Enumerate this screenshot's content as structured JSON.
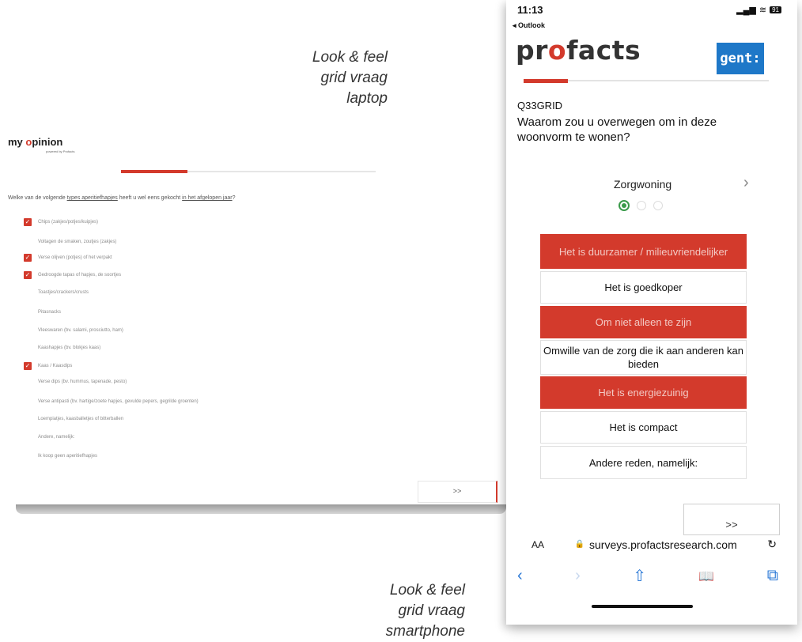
{
  "captions": {
    "laptop": [
      "Look & feel",
      "grid vraag",
      "laptop"
    ],
    "smartphone": [
      "Look & feel",
      "grid vraag",
      "smartphone"
    ]
  },
  "laptop": {
    "logo_text": "my",
    "logo_o": "o",
    "logo_rest": "pinion",
    "logo_subtitle": "powered by Profacts",
    "progress_fraction": 0.26,
    "question_prefix": "Welke van de volgende ",
    "question_link1": "types aperitiefhapjes",
    "question_middle": " heeft u wel eens gekocht ",
    "question_link2": "in het afgelopen jaar",
    "question_suffix": "?",
    "options": [
      {
        "label": "Chips (zakjes/potjes/kuipjes)",
        "checked": true
      },
      {
        "label": "Voltagen de smaken, zoutjes (zakjes)",
        "checked": false
      },
      {
        "label": "Verse olijven (potjes) of het verpakt",
        "checked": true
      },
      {
        "label": "Gedroogde tapas of hapjes, de soortjes",
        "checked": true
      },
      {
        "label": "Toastjes/crackers/crusts",
        "checked": false
      },
      {
        "label": "Pitasnacks",
        "checked": false
      },
      {
        "label": "Vleeswaren (bv. salami, prosciutto, ham)",
        "checked": false
      },
      {
        "label": "Kaashapjes (bv. blokjes kaas)",
        "checked": false
      },
      {
        "label": "Kaas / Kaasdips",
        "checked": true
      },
      {
        "label": "Verse dips (bv. hummus, tapenade, pesto)",
        "checked": false
      },
      {
        "label": "Verse antipasti (bv. hartige/zoete hapjes, gevulde pepers, gegrilde groenten)",
        "checked": false
      },
      {
        "label": "Loempiatjes, kaasballetjes of bitterballen",
        "checked": false
      },
      {
        "label": "Andere, namelijk:",
        "checked": false
      },
      {
        "label": "Ik koop geen aperitiefhapjes",
        "checked": false
      }
    ],
    "next_label": ">>"
  },
  "phone": {
    "time": "11:13",
    "back_app": "◂ Outlook",
    "battery": "91",
    "brand_pre": "pr",
    "brand_o": "o",
    "brand_post": "facts",
    "gent_logo": "gent:",
    "progress_fraction": 0.18,
    "question_id": "Q33GRID",
    "question_text": "Waarom zou u overwegen om in deze woonvorm te wonen?",
    "item_name": "Zorgwoning",
    "chevron": "›",
    "answers": [
      {
        "label": "Het is duurzamer / milieuvriendelijker",
        "selected": true
      },
      {
        "label": "Het is goedkoper",
        "selected": false
      },
      {
        "label": "Om niet alleen te zijn",
        "selected": true
      },
      {
        "label": "Omwille van de zorg die ik aan anderen kan bieden",
        "selected": false
      },
      {
        "label": "Het is energiezuinig",
        "selected": true
      },
      {
        "label": "Het is compact",
        "selected": false
      },
      {
        "label": "Andere reden, namelijk:",
        "selected": false
      }
    ],
    "next_label": ">>",
    "url_aa": "AA",
    "url": "surveys.profactsresearch.com",
    "reload_icon": "↻",
    "lock_icon": "🔒",
    "toolbar_icons": [
      "‹",
      "›",
      "⇧",
      "📖",
      "⧉"
    ]
  }
}
